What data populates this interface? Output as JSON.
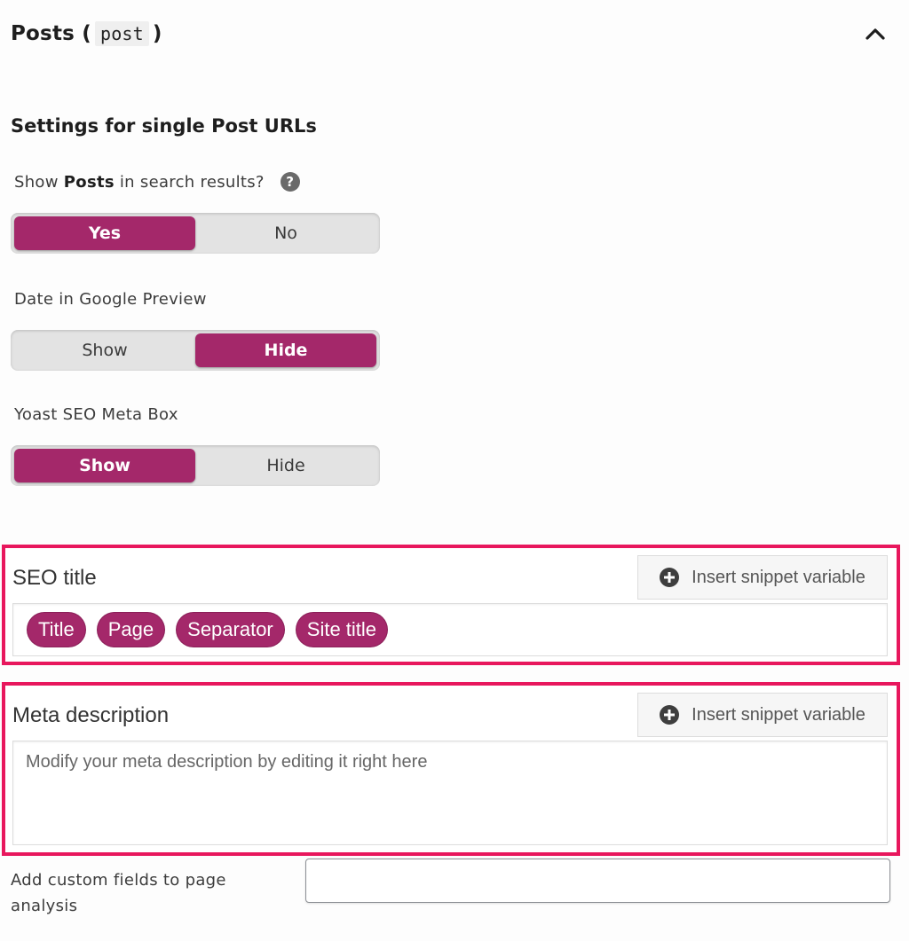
{
  "section": {
    "title": "Posts (",
    "code": "post",
    "title_end": ")",
    "collapse_icon": "chevron-up-icon"
  },
  "subheading": "Settings for single Post URLs",
  "fields": {
    "show_in_search": {
      "label_pre": "Show",
      "label_bold": "Posts",
      "label_post": "in search results?",
      "help_icon": "?",
      "options": [
        "Yes",
        "No"
      ],
      "selected": "Yes"
    },
    "date_preview": {
      "label": "Date in Google Preview",
      "options": [
        "Show",
        "Hide"
      ],
      "selected": "Hide"
    },
    "meta_box": {
      "label": "Yoast SEO Meta Box",
      "options": [
        "Show",
        "Hide"
      ],
      "selected": "Show"
    }
  },
  "seo_title": {
    "label": "SEO title",
    "button_label": "Insert snippet variable",
    "chips": [
      "Title",
      "Page",
      "Separator",
      "Site title"
    ]
  },
  "meta_description": {
    "label": "Meta description",
    "button_label": "Insert snippet variable",
    "placeholder": "Modify your meta description by editing it right here"
  },
  "custom_fields": {
    "label": "Add custom fields to page analysis",
    "value": ""
  },
  "colors": {
    "accent": "#a4286a",
    "highlight": "#e8175d"
  }
}
